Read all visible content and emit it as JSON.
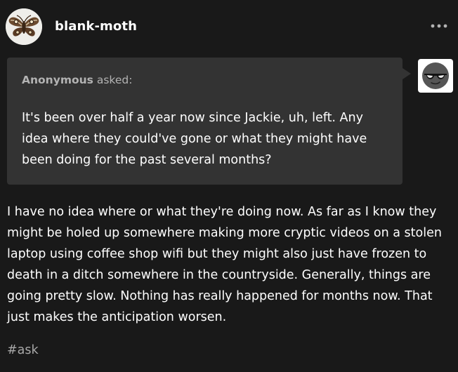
{
  "post": {
    "username": "blank-moth",
    "blog_avatar_icon": "moth-icon",
    "more_icon": "more-options-icon",
    "ask": {
      "asker": "Anonymous",
      "asked_label": " asked:",
      "asker_avatar_icon": "sunglasses-face-icon",
      "question": "It's been over half a year now since Jackie, uh, left. Any idea where they could've gone or what they might have been doing for the past several months?"
    },
    "answer": "I have no idea where or what they're doing now. As far as I know they might be holed up somewhere making more cryptic videos on a stolen laptop using coffee shop wifi but they might also just have frozen to death in a ditch somewhere in the countryside. Generally, things are going pretty slow. Nothing has really happened for months now. That just makes the anticipation worsen.",
    "tags": [
      "#ask"
    ]
  },
  "colors": {
    "background": "#191919",
    "ask_box": "#333333",
    "muted_text": "#b3b3b3",
    "tag_text": "#a8a8a8"
  }
}
